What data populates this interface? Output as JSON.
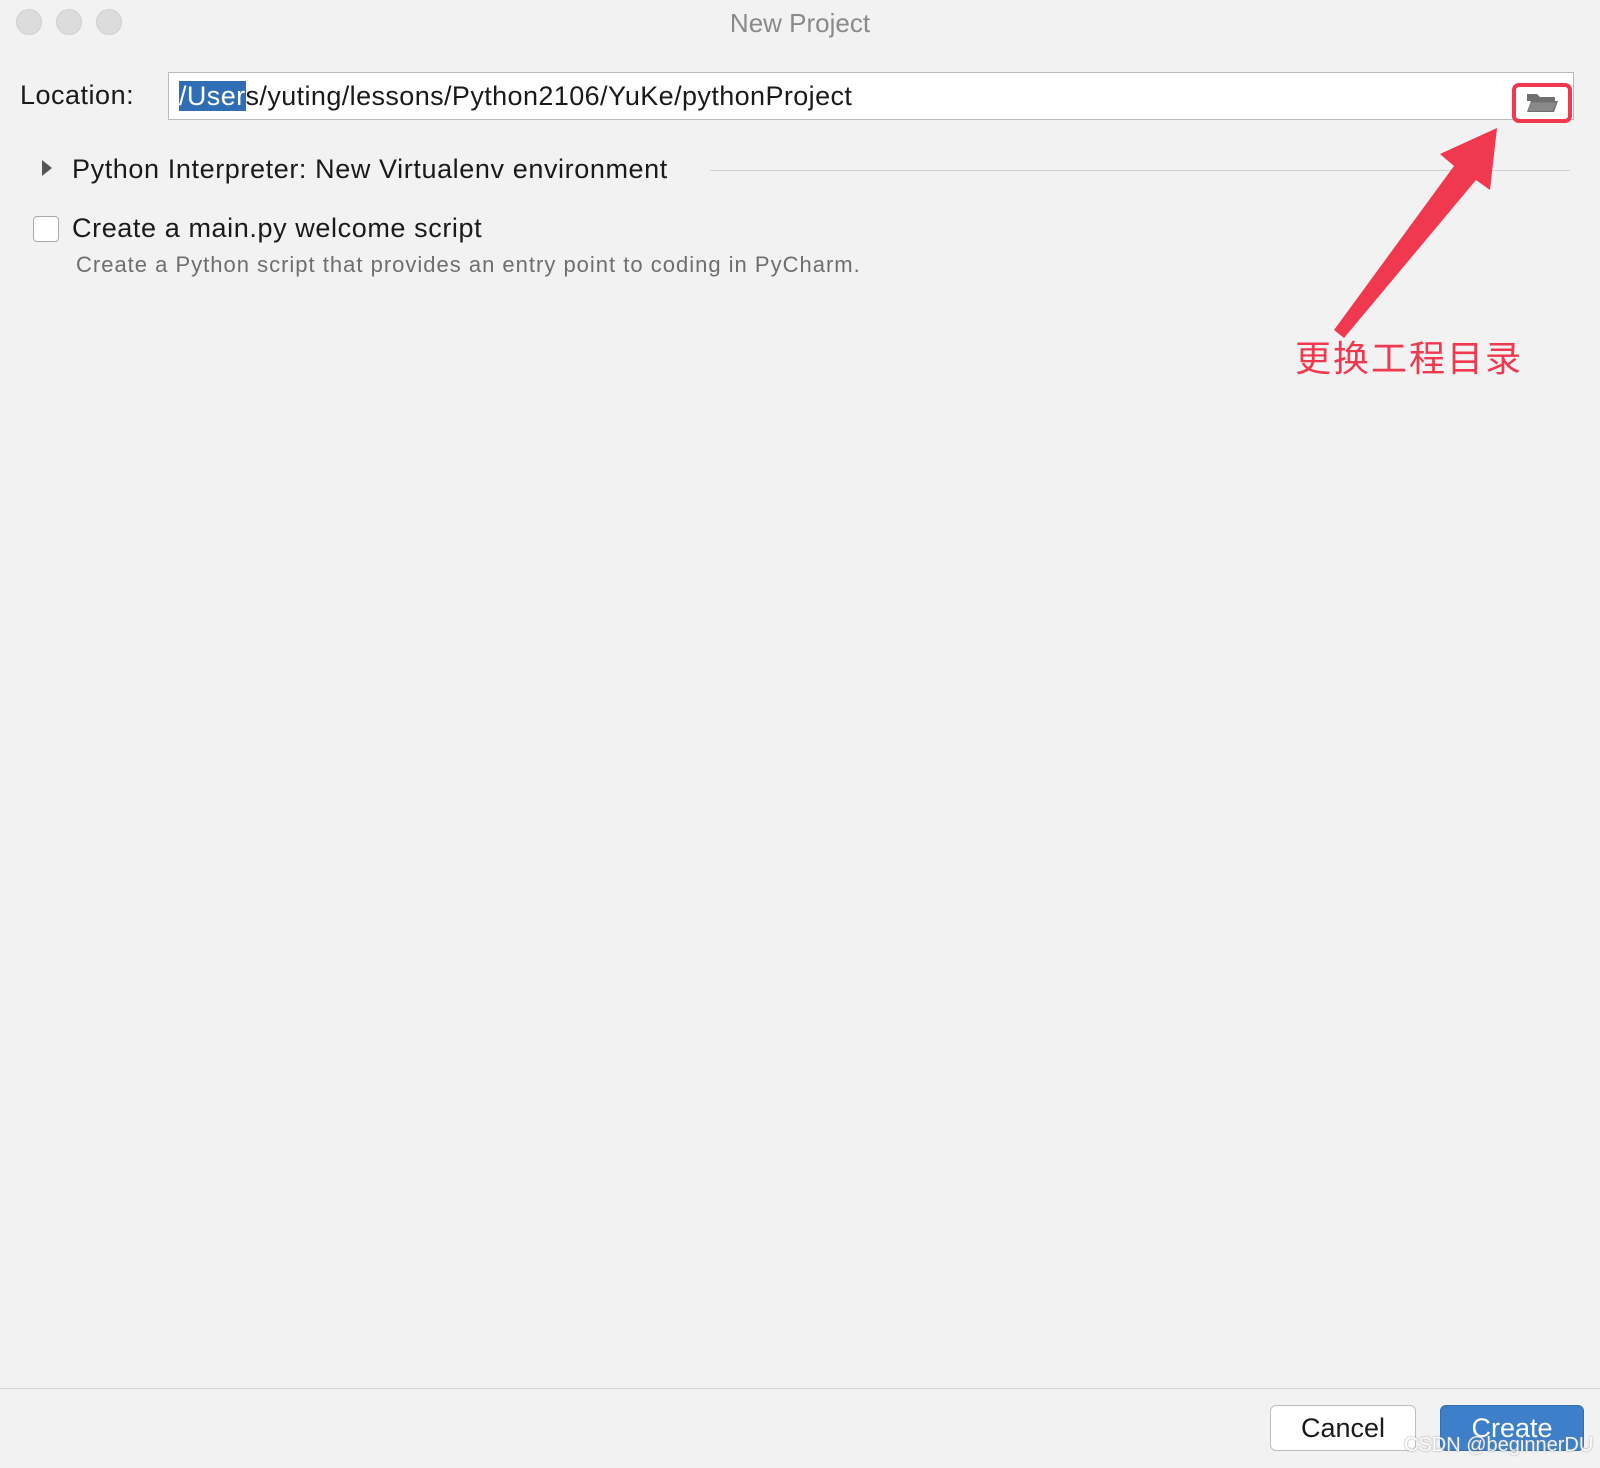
{
  "window": {
    "title": "New Project"
  },
  "location": {
    "label": "Location:",
    "value_selected": "/User",
    "value_rest": "s/yuting/lessons/Python2106/YuKe/pythonProject",
    "browse_icon": "folder-open-icon"
  },
  "interpreter": {
    "label": "Python Interpreter: New Virtualenv environment",
    "expand_icon": "triangle-right-icon"
  },
  "welcome_script": {
    "label": "Create a main.py welcome script",
    "description": "Create a Python script that provides an entry point to coding in PyCharm.",
    "checked": false
  },
  "annotation": {
    "text": "更换工程目录",
    "color": "#f0384e"
  },
  "footer": {
    "cancel_label": "Cancel",
    "create_label": "Create"
  },
  "watermark": {
    "text": "CSDN @beginnerDU"
  },
  "colors": {
    "accent": "#3d7fc8",
    "selection": "#2f6db5",
    "annotation": "#f0384e"
  }
}
